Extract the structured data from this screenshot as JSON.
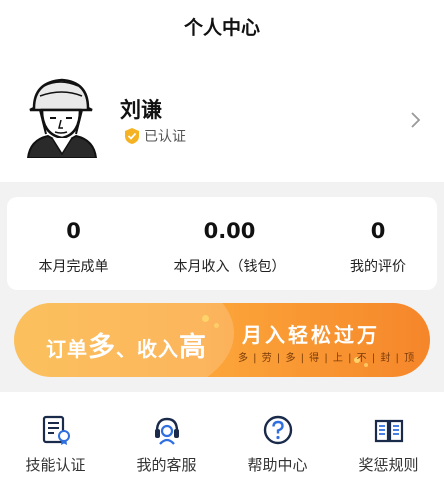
{
  "header": {
    "title": "个人中心"
  },
  "profile": {
    "name": "刘谦",
    "verified_label": "已认证"
  },
  "stats": [
    {
      "value": "0",
      "label": "本月完成单"
    },
    {
      "value": "0.00",
      "label": "本月收入（钱包）"
    },
    {
      "value": "0",
      "label": "我的评价"
    }
  ],
  "banner": {
    "slogan_part1": "订单",
    "slogan_big1": "多",
    "slogan_part2": "、收入",
    "slogan_big2": "高",
    "promo": "月入轻松过万",
    "motto": "多 | 劳 | 多 | 得 | 上 | 不 | 封 | 顶"
  },
  "tools": [
    {
      "label": "技能认证",
      "icon": "certificate-icon"
    },
    {
      "label": "我的客服",
      "icon": "headset-icon"
    },
    {
      "label": "帮助中心",
      "icon": "help-icon"
    },
    {
      "label": "奖惩规则",
      "icon": "book-icon"
    }
  ],
  "colors": {
    "accent": "#1a2a4a",
    "banner_start": "#fbb33a",
    "banner_end": "#f5862a",
    "badge": "#f5b323"
  }
}
